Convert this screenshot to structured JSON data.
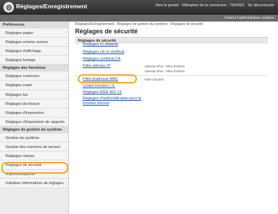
{
  "header": {
    "title": "Réglages/Enregistrement",
    "links": [
      "Vers le portail",
      "Utilisateur de la connexion : 7654321",
      "Se déconnecter"
    ],
    "admin_mail": "Email à l'administrateur système"
  },
  "sidebar": {
    "preferences_header": "Préférences",
    "preferences": [
      "Réglages papier",
      "Réglages volume sonore",
      "Réglages d'affichage",
      "Réglages horloge"
    ],
    "functions_header": "Réglages des fonctions",
    "functions": [
      "Réglages communs",
      "Réglages copie",
      "Réglages fax",
      "Réglages de lecture",
      "Réglages d'impression",
      "Réglages d'impression de rapports"
    ],
    "management_header": "Réglages de gestion du système",
    "management": [
      "Gestion du système",
      "Gestion des numéros de service",
      "Réglages réseau",
      "Réglages de sécurité",
      "Importer/Exporter",
      "Initialiser informations de réglages"
    ]
  },
  "main": {
    "breadcrumb": "Réglages/Enregistrement : Réglages de gestion du système : Réglages de sécurité",
    "title": "Réglages de sécurité",
    "section_title": "Réglages de sécurité",
    "items": [
      {
        "label": "Réglages IU distante",
        "note": ""
      },
      {
        "label": "Réglages clé et certificat",
        "note": ""
      },
      {
        "label": "Réglages certificat CA",
        "note": ""
      },
      {
        "label": "Filtre adresse IP",
        "note": "Adresse IPv4 : Filtre d'entrée"
      },
      {
        "label": "",
        "note": "Adresse IPv6 : Filtre d'entrée"
      },
      {
        "label": "Filtre d'adresse MAC",
        "note": "Filtre d'entrée"
      },
      {
        "label": "Limiter fonction I.X.",
        "note": ""
      },
      {
        "label": "Réglages IEEE 802.1X",
        "note": ""
      },
      {
        "label": "Réglages d'authentification pour la",
        "note": ""
      },
      {
        "label": "fonction d'envoi",
        "note": ""
      }
    ]
  },
  "colors": {
    "accent_highlight": "#f5a623",
    "link": "#1a4e9b",
    "topbar": "#3a3a3a"
  }
}
